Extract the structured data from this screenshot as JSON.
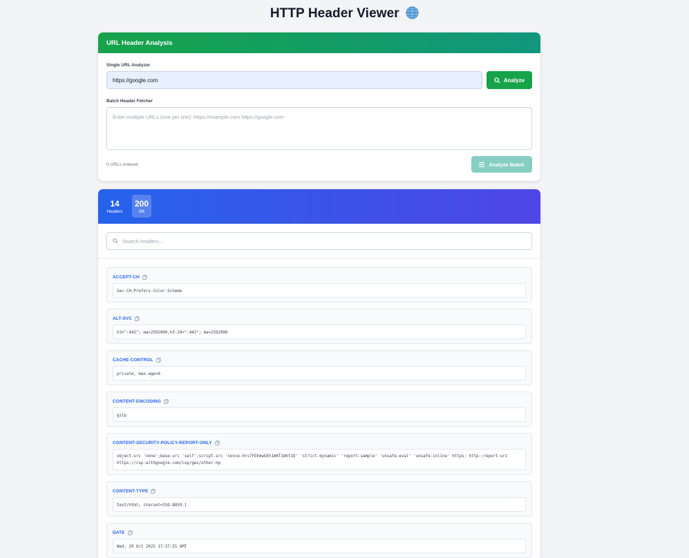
{
  "page": {
    "title": "HTTP Header Viewer"
  },
  "analysis_card": {
    "header": "URL Header Analysis",
    "single_label": "Single URL Analyzer",
    "url_value": "https://google.com",
    "analyze_label": "Analyze",
    "batch_label": "Batch Header Fetcher",
    "batch_placeholder": "Enter multiple URLs (one per line): https://example.com https://google.com",
    "url_count": "0 URLs entered",
    "batch_button_label": "Analyze Batch"
  },
  "results": {
    "header_count": "14",
    "header_count_label": "Headers",
    "status_code": "200",
    "status_text": "OK",
    "search_placeholder": "Search headers...",
    "headers": [
      {
        "name": "ACCEPT-CH",
        "value": "Sec-CH-Prefers-Color-Scheme"
      },
      {
        "name": "ALT-SVC",
        "value": "h3=\":443\"; ma=2592000,h3-29=\":443\"; ma=2592000"
      },
      {
        "name": "CACHE-CONTROL",
        "value": "private, max-age=0"
      },
      {
        "name": "CONTENT-ENCODING",
        "value": "gzip"
      },
      {
        "name": "CONTENT-SECURITY-POLICY-REPORT-ONLY",
        "value": "object-src 'none';base-uri 'self';script-src 'nonce-0rs7FEEmwGEh1mKTzbKt1Q' 'strict-dynamic' 'report-sample' 'unsafe-eval' 'unsafe-inline' https: http:;report-uri https://csp.withgoogle.com/csp/gws/other-hp"
      },
      {
        "name": "CONTENT-TYPE",
        "value": "text/html; charset=ISO-8859-1"
      },
      {
        "name": "DATE",
        "value": "Wed, 29 Oct 2025 17:37:55 GMT"
      }
    ]
  }
}
